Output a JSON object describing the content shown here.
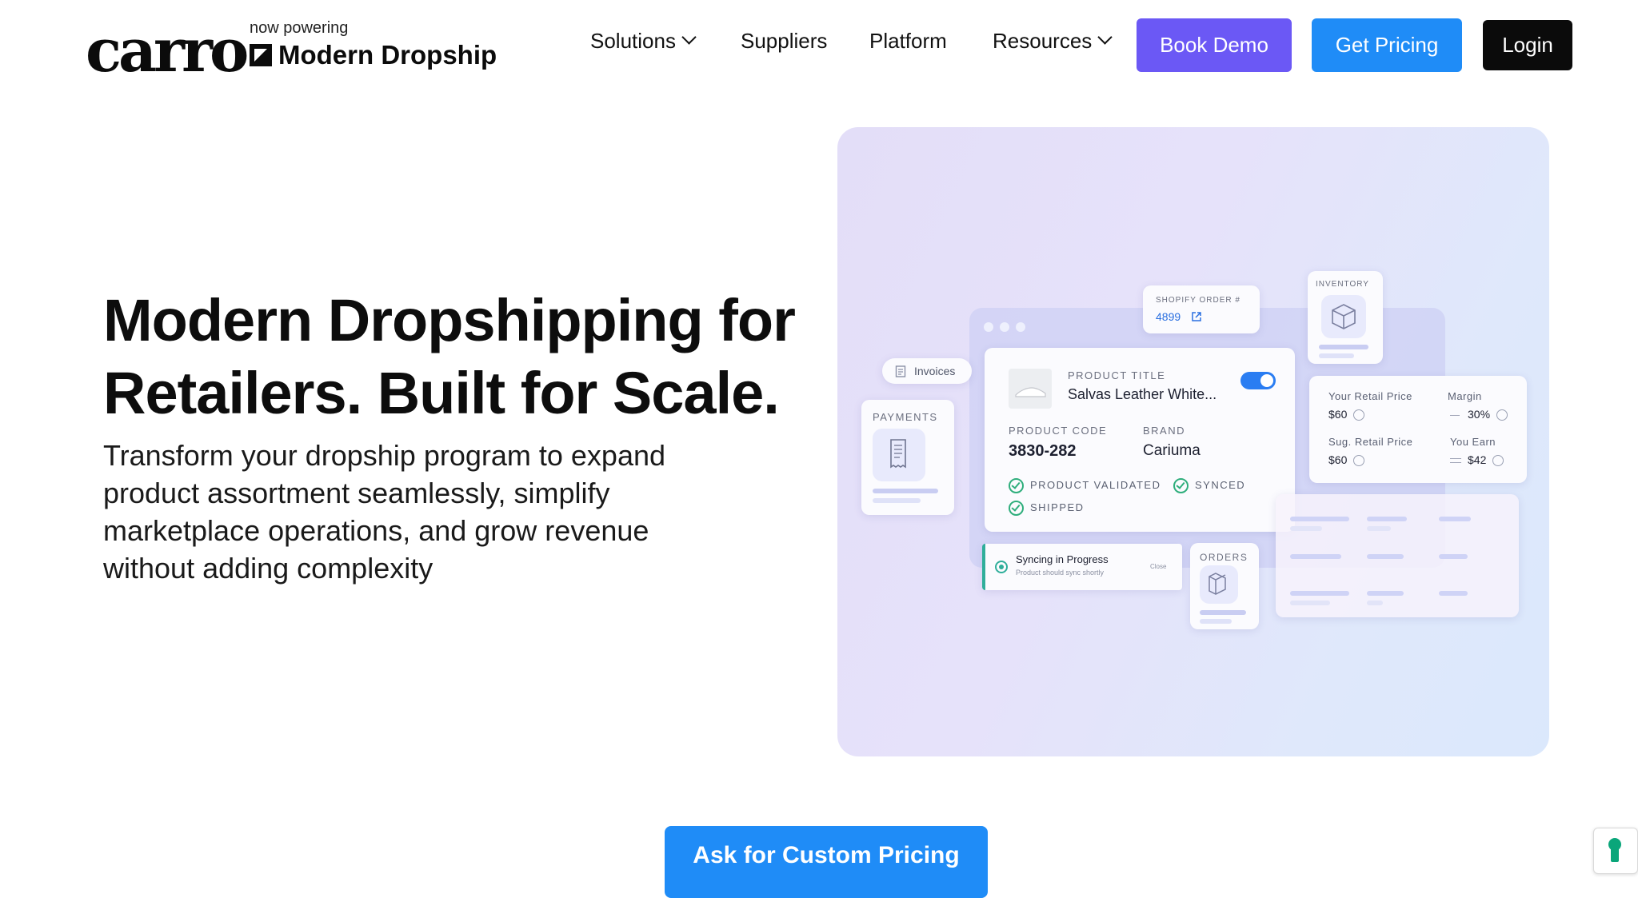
{
  "logo": {
    "wordmark": "carro",
    "powering": "now powering",
    "product": "Modern Dropship"
  },
  "nav": {
    "solutions": "Solutions",
    "suppliers": "Suppliers",
    "platform": "Platform",
    "resources": "Resources"
  },
  "buttons": {
    "book_demo": "Book Demo",
    "get_pricing": "Get Pricing",
    "login": "Login",
    "custom_pricing": "Ask for Custom Pricing"
  },
  "colors": {
    "book_demo": "#6b58f5",
    "get_pricing": "#1f8cf7",
    "login": "#0b0b0b",
    "cta": "#1f8cf7",
    "toggle": "#2a7df2"
  },
  "hero": {
    "title_line1": "Modern Dropshipping for",
    "title_line2": "Retailers. Built for Scale.",
    "lede": "Transform your dropship program to expand product assortment seamlessly, simplify marketplace operations, and grow revenue without adding complexity"
  },
  "illustration": {
    "shopify_label": "SHOPIFY ORDER #",
    "shopify_value": "4899",
    "inventory_label": "INVENTORY",
    "invoices_label": "Invoices",
    "payments_label": "PAYMENTS",
    "product_title_label": "PRODUCT TITLE",
    "product_title_value": "Salvas Leather White...",
    "product_code_label": "PRODUCT CODE",
    "product_code_value": "3830-282",
    "brand_label": "BRAND",
    "brand_value": "Cariuma",
    "validated": "PRODUCT VALIDATED",
    "synced": "SYNCED",
    "shipped": "SHIPPED",
    "retail_price_label": "Your Retail Price",
    "retail_price_value": "$60",
    "margin_label": "Margin",
    "margin_value": "30%",
    "sug_price_label": "Sug. Retail Price",
    "sug_price_value": "$60",
    "earn_label": "You Earn",
    "earn_value": "$42",
    "syncing_title": "Syncing in Progress",
    "syncing_sub": "Product should sync shortly",
    "close": "Close",
    "orders_label": "ORDERS",
    "toggle_on": true
  },
  "icons": {
    "nav_dropdown": "chevron-down-icon",
    "external_link": "external-link-icon",
    "inventory": "box-icon",
    "payments": "receipt-icon",
    "orders": "box-icon",
    "invoices": "document-icon",
    "help_widget": "keyhole-icon"
  }
}
